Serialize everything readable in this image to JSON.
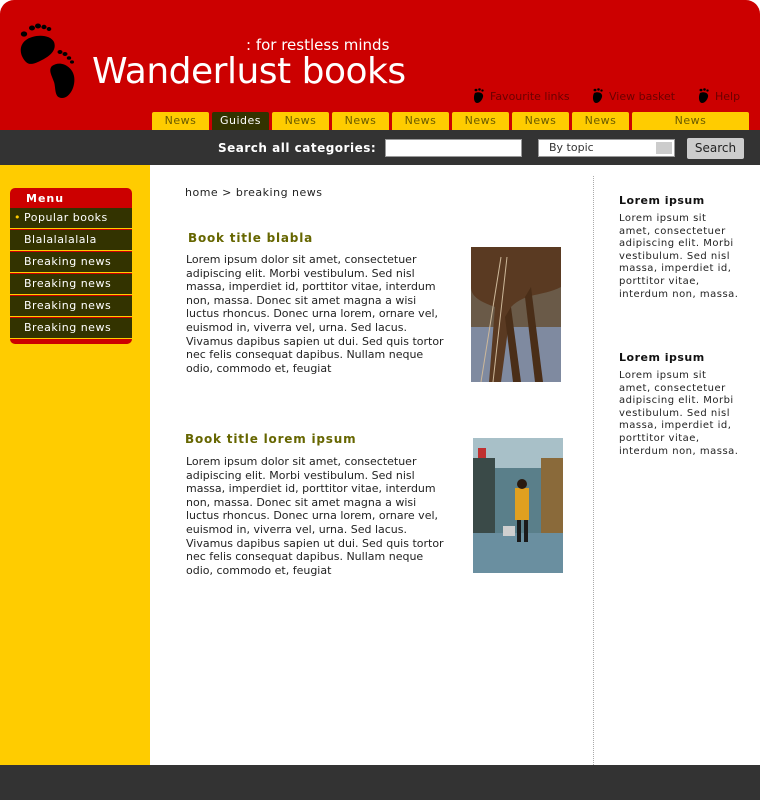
{
  "header": {
    "tagline": ": for restless minds",
    "site_title": "Wanderlust books",
    "util_links": [
      {
        "label": "Favourite links",
        "icon": "footprint-icon"
      },
      {
        "label": "View basket",
        "icon": "footprint-icon"
      },
      {
        "label": "Help",
        "icon": "footprint-icon"
      }
    ],
    "colors": {
      "brand_red": "#cc0000",
      "accent_yellow": "#ffcc00",
      "dark_olive": "#333300",
      "bar_dark": "#333333"
    }
  },
  "tabs": [
    {
      "label": "News",
      "active": false
    },
    {
      "label": "Guides",
      "active": true
    },
    {
      "label": "News",
      "active": false
    },
    {
      "label": "News",
      "active": false
    },
    {
      "label": "News",
      "active": false
    },
    {
      "label": "News",
      "active": false
    },
    {
      "label": "News",
      "active": false
    },
    {
      "label": "News",
      "active": false
    },
    {
      "label": "News",
      "active": false
    }
  ],
  "search": {
    "label": "Search all categories:",
    "input_value": "",
    "select_value": "By topic",
    "button_label": "Search"
  },
  "menu": {
    "title": "Menu",
    "items": [
      {
        "label": "Popular books",
        "active": true
      },
      {
        "label": "Blalalalalala",
        "active": false
      },
      {
        "label": "Breaking news",
        "active": false
      },
      {
        "label": "Breaking news",
        "active": false
      },
      {
        "label": "Breaking news",
        "active": false
      },
      {
        "label": "Breaking news",
        "active": false
      }
    ]
  },
  "breadcrumb": "home > breaking news",
  "articles": [
    {
      "title": "Book title blabla",
      "body": "Lorem ipsum dolor sit amet, consectetuer adipiscing elit. Morbi vestibulum. Sed nisl massa, imperdiet id, porttitor vitae, interdum non, massa. Donec sit amet magna a wisi luctus rhoncus. Donec urna lorem, ornare vel, euismod in, viverra vel, urna. Sed lacus. Vivamus dapibus sapien ut dui. Sed quis tortor nec felis consequat dapibus. Nullam neque odio, commodo et, feugiat",
      "image": "camel-legs-photo"
    },
    {
      "title": "Book title lorem ipsum",
      "body": "Lorem ipsum dolor sit amet, consectetuer adipiscing elit. Morbi vestibulum. Sed nisl massa, imperdiet id, porttitor vitae, interdum non, massa. Donec sit amet magna a wisi luctus rhoncus. Donec urna lorem, ornare vel, euismod in, viverra vel, urna. Sed lacus. Vivamus dapibus sapien ut dui. Sed quis tortor nec felis consequat dapibus. Nullam neque odio, commodo et, feugiat",
      "image": "market-street-photo"
    }
  ],
  "right_col": [
    {
      "title": "Lorem ipsum",
      "text": "Lorem ipsum sit amet, consectetuer adipiscing elit. Morbi vestibulum. Sed nisl massa, imperdiet id, porttitor vitae, interdum non, massa."
    },
    {
      "title": "Lorem ipsum",
      "text": "Lorem ipsum sit amet, consectetuer adipiscing elit. Morbi vestibulum. Sed nisl massa, imperdiet id, porttitor vitae, interdum non, massa."
    }
  ]
}
